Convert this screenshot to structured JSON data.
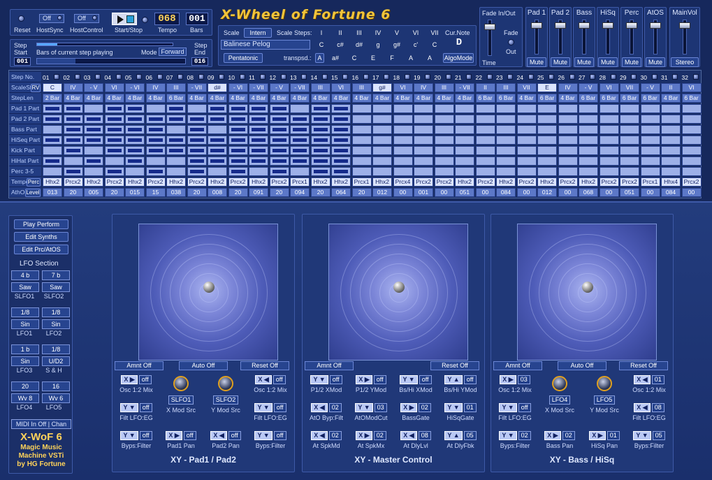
{
  "app": {
    "title": "X-Wheel of Fortune 6"
  },
  "top": {
    "reset": "Reset",
    "hostsync_val": "Off",
    "hostsync": "HostSync",
    "hostcontrol_val": "Off",
    "hostcontrol": "HostControl",
    "startstop": "Start/Stop",
    "tempo_val": "068",
    "tempo": "Tempo",
    "bars_val": "001",
    "bars": "Bars"
  },
  "step": {
    "step_start": "Step",
    "start": "Start",
    "start_val": "001",
    "bars_playing": "Bars of current step playing",
    "mode": "Mode",
    "mode_val": "Forward",
    "step_end": "Step",
    "end": "End",
    "end_val": "016"
  },
  "scale": {
    "scale": "Scale",
    "intern": "Intern",
    "scale_steps": "Scale Steps:",
    "name": "Balinese Pelog",
    "pentatonic": "Pentatonic",
    "transpsd": "transpsd.:",
    "transp_val": "A",
    "curnote": "Cur.Note",
    "curnote_val": "D",
    "algomode": "AlgoMode",
    "degrees": [
      "I",
      "II",
      "III",
      "IV",
      "V",
      "VI",
      "VII"
    ],
    "notes": [
      "C",
      "c#",
      "d#",
      "g",
      "g#",
      "c'",
      "C"
    ],
    "tnotes": [
      "a#",
      "C",
      "E",
      "F",
      "A",
      "A"
    ]
  },
  "fade": {
    "fadeinout": "Fade In/Out",
    "fade": "Fade",
    "out": "Out",
    "time": "Time"
  },
  "channels": [
    {
      "name": "Pad 1",
      "mute": "Mute"
    },
    {
      "name": "Pad 2",
      "mute": "Mute"
    },
    {
      "name": "Bass",
      "mute": "Mute"
    },
    {
      "name": "HiSq",
      "mute": "Mute"
    },
    {
      "name": "Perc",
      "mute": "Mute"
    },
    {
      "name": "AtOS",
      "mute": "Mute"
    },
    {
      "name": "MainVol",
      "mute": "Stereo"
    }
  ],
  "seq": {
    "labels": {
      "stepno": "Step No.",
      "scalestep": "ScaleStep",
      "rv": "RV",
      "steplen": "StepLen Bars",
      "pad1": "Pad 1 Part",
      "pad2": "Pad 2 Part",
      "bass": "Bass Part",
      "hiseq": "HiSeq Part",
      "kick": "Kick Part",
      "hihat": "HiHat Part",
      "perc": "Perc 3-5 Part",
      "tempo": "Tempo",
      "tempo_btn": "Perc",
      "athos": "AthOs",
      "athos_btn": "Level"
    },
    "steps": [
      "01",
      "02",
      "03",
      "04",
      "05",
      "06",
      "07",
      "08",
      "09",
      "10",
      "11",
      "12",
      "13",
      "14",
      "15",
      "16",
      "17",
      "18",
      "19",
      "20",
      "21",
      "22",
      "23",
      "24",
      "25",
      "26",
      "27",
      "28",
      "29",
      "30",
      "31",
      "32"
    ],
    "scalesteps": [
      "C",
      "IV",
      "- V",
      "VI",
      "- VI",
      "IV",
      "III",
      "- VII",
      "d#",
      "- VI",
      "- VII",
      "- V",
      "- VII",
      "III",
      "VI",
      "III",
      "g#",
      "VI",
      "IV",
      "III",
      "- VII",
      "II",
      "III",
      "VII",
      "E",
      "IV",
      "- V",
      "VI",
      "VII",
      "- V",
      "II",
      "VI"
    ],
    "steplens": [
      "2 Bar",
      "4 Bar",
      "4 Bar",
      "4 Bar",
      "4 Bar",
      "4 Bar",
      "6 Bar",
      "4 Bar",
      "4 Bar",
      "4 Bar",
      "4 Bar",
      "4 Bar",
      "4 Bar",
      "4 Bar",
      "4 Bar",
      "4 Bar",
      "4 Bar",
      "4 Bar",
      "4 Bar",
      "4 Bar",
      "4 Bar",
      "6 Bar",
      "6 Bar",
      "4 Bar",
      "6 Bar",
      "4 Bar",
      "6 Bar",
      "6 Bar",
      "6 Bar",
      "6 Bar",
      "4 Bar",
      "6 Bar"
    ],
    "tempos": [
      "Hhx2",
      "Prcx2",
      "Hhx2",
      "Prcx2",
      "Hhx2",
      "Prcx2",
      "Hhx2",
      "Prcx2",
      "Hhx2",
      "Prcx2",
      "Hhx2",
      "Prcx2",
      "Prcx1",
      "Hhx2",
      "Hhx2",
      "Prcx1",
      "Hhx2",
      "Prcx4",
      "Prcx2",
      "Prcx2",
      "Hhx2",
      "Prcx2",
      "Hhx2",
      "Prcx2",
      "Hhx2",
      "Prcx2",
      "Hhx2",
      "Prcx2",
      "Prcx2",
      "Prcx1",
      "Hhx4",
      "Prcx2"
    ],
    "levels": [
      "013",
      "20",
      "005",
      "20",
      "015",
      "15",
      "038",
      "20",
      "008",
      "20",
      "091",
      "20",
      "094",
      "20",
      "064",
      "20",
      "012",
      "00",
      "001",
      "00",
      "051",
      "00",
      "084",
      "00",
      "012",
      "00",
      "068",
      "00",
      "051",
      "00",
      "084",
      "00"
    ],
    "pattern": {
      "pad1": [
        1,
        1,
        0,
        1,
        1,
        0,
        1,
        0,
        1,
        1,
        1,
        1,
        0,
        1,
        1,
        0
      ],
      "pad2": [
        1,
        1,
        1,
        1,
        1,
        1,
        1,
        1,
        1,
        1,
        1,
        1,
        1,
        1,
        1,
        0
      ],
      "bass": [
        0,
        1,
        1,
        1,
        1,
        1,
        0,
        1,
        0,
        1,
        1,
        1,
        1,
        1,
        1,
        0
      ],
      "hiseq": [
        1,
        1,
        1,
        1,
        1,
        1,
        1,
        1,
        1,
        1,
        1,
        1,
        1,
        1,
        1,
        0
      ],
      "kick": [
        0,
        1,
        0,
        1,
        1,
        1,
        1,
        1,
        1,
        1,
        1,
        1,
        1,
        1,
        1,
        0
      ],
      "hihat": [
        1,
        0,
        1,
        0,
        1,
        0,
        0,
        1,
        1,
        1,
        1,
        1,
        1,
        1,
        1,
        0
      ],
      "perc": [
        0,
        1,
        0,
        1,
        0,
        1,
        0,
        1,
        0,
        1,
        0,
        1,
        0,
        1,
        1,
        0
      ]
    }
  },
  "side": {
    "play": "Play Perform",
    "synths": "Edit Synths",
    "prc": "Edit Prc/AtOS",
    "lfo_section": "LFO Section",
    "lfos": [
      {
        "a": "4 b",
        "b": "7 b",
        "wa": "Saw",
        "wb": "Saw",
        "na": "SLFO1",
        "nb": "SLFO2"
      },
      {
        "a": "1/8",
        "b": "1/8",
        "wa": "Sin",
        "wb": "Sin",
        "na": "LFO1",
        "nb": "LFO2"
      },
      {
        "a": "1 b",
        "b": "1/8",
        "wa": "Sin",
        "wb": "U/D2",
        "na": "LFO3",
        "nb": "S & H"
      },
      {
        "a": "20",
        "b": "16",
        "wa": "Wv 8",
        "wb": "Wv 6",
        "na": "LFO4",
        "nb": "LFO5"
      }
    ],
    "midi": "MIDI In Off",
    "chan": "Chan",
    "brand": "X-WoF 6",
    "tag1": "Magic Music",
    "tag2": "Machine VSTi",
    "tag3": "by HG Fortune"
  },
  "xy": [
    {
      "title": "XY - Pad1 / Pad2",
      "amnt": "Amnt Off",
      "auto": "Auto Off",
      "reset": "Reset Off",
      "ctrls": [
        {
          "m": "X ▶",
          "v": "off",
          "c": "Osc 1:2 Mix"
        },
        {
          "k": 1,
          "v": "SLFO1",
          "c": "X Mod Src"
        },
        {
          "k": 1,
          "v": "SLFO2",
          "c": "Y Mod Src"
        },
        {
          "m": "X ◀",
          "v": "off",
          "c": "Osc 1:2 Mix"
        },
        {
          "m": "Y ▼",
          "v": "off",
          "c": "Filt LFO:EG"
        },
        {
          "m": "Y ▼",
          "v": "off",
          "c": "Filt LFO:EG"
        },
        {
          "m": "Y ▼",
          "v": "off",
          "c": "Byps:Filter"
        },
        {
          "m": "X ▶",
          "v": "off",
          "c": "Pad1 Pan"
        },
        {
          "m": "X ◀",
          "v": "off",
          "c": "Pad2 Pan"
        },
        {
          "m": "Y ▼",
          "v": "off",
          "c": "Byps:Filter"
        }
      ]
    },
    {
      "title": "XY - Master Control",
      "amnt": "Amnt Off",
      "auto": "",
      "reset": "Reset Off",
      "ctrls": [
        {
          "m": "Y ▼",
          "v": "off",
          "c": "P1/2 XMod"
        },
        {
          "m": "X ▶",
          "v": "off",
          "c": "P1/2 YMod"
        },
        {
          "m": "Y ▼",
          "v": "off",
          "c": "Bs/Hi XMod"
        },
        {
          "m": "Y ▲",
          "v": "off",
          "c": "Bs/Hi YMod"
        },
        {
          "m": "X ◀",
          "v": "02",
          "c": "AtO Byp:Filt"
        },
        {
          "m": "Y ▼",
          "v": "03",
          "c": "AtOModCut"
        },
        {
          "m": "X ▶",
          "v": "02",
          "c": "BassGate"
        },
        {
          "m": "Y ▼",
          "v": "01",
          "c": "HiSqGate"
        },
        {
          "m": "X ◀",
          "v": "02",
          "c": "At SpkMd"
        },
        {
          "m": "X ▶",
          "v": "02",
          "c": "At SpkMx"
        },
        {
          "m": "X ◀",
          "v": "08",
          "c": "At DlyLvl"
        },
        {
          "m": "Y ▲",
          "v": "05",
          "c": "At DlyFbk"
        }
      ]
    },
    {
      "title": "XY - Bass / HiSq",
      "amnt": "Amnt Off",
      "auto": "Auto Off",
      "reset": "Reset Off",
      "ctrls": [
        {
          "m": "X ▶",
          "v": "03",
          "c": "Osc 1:2 Mix"
        },
        {
          "k": 1,
          "v": "LFO4",
          "c": "X Mod Src"
        },
        {
          "k": 1,
          "v": "LFO5",
          "c": "Y Mod Src"
        },
        {
          "m": "X ◀",
          "v": "01",
          "c": "Osc 1:2 Mix"
        },
        {
          "m": "Y ▼",
          "v": "off",
          "c": "Filt LFO:EG"
        },
        {
          "m": "X ◀",
          "v": "08",
          "c": "Filt LFO:EG"
        },
        {
          "m": "Y ▼",
          "v": "02",
          "c": "Byps:Filter"
        },
        {
          "m": "X ▶",
          "v": "02",
          "c": "Bass Pan"
        },
        {
          "m": "X ▶",
          "v": "01",
          "c": "HiSq Pan"
        },
        {
          "m": "Y ▼",
          "v": "05",
          "c": "Byps:Filter"
        }
      ]
    }
  ]
}
